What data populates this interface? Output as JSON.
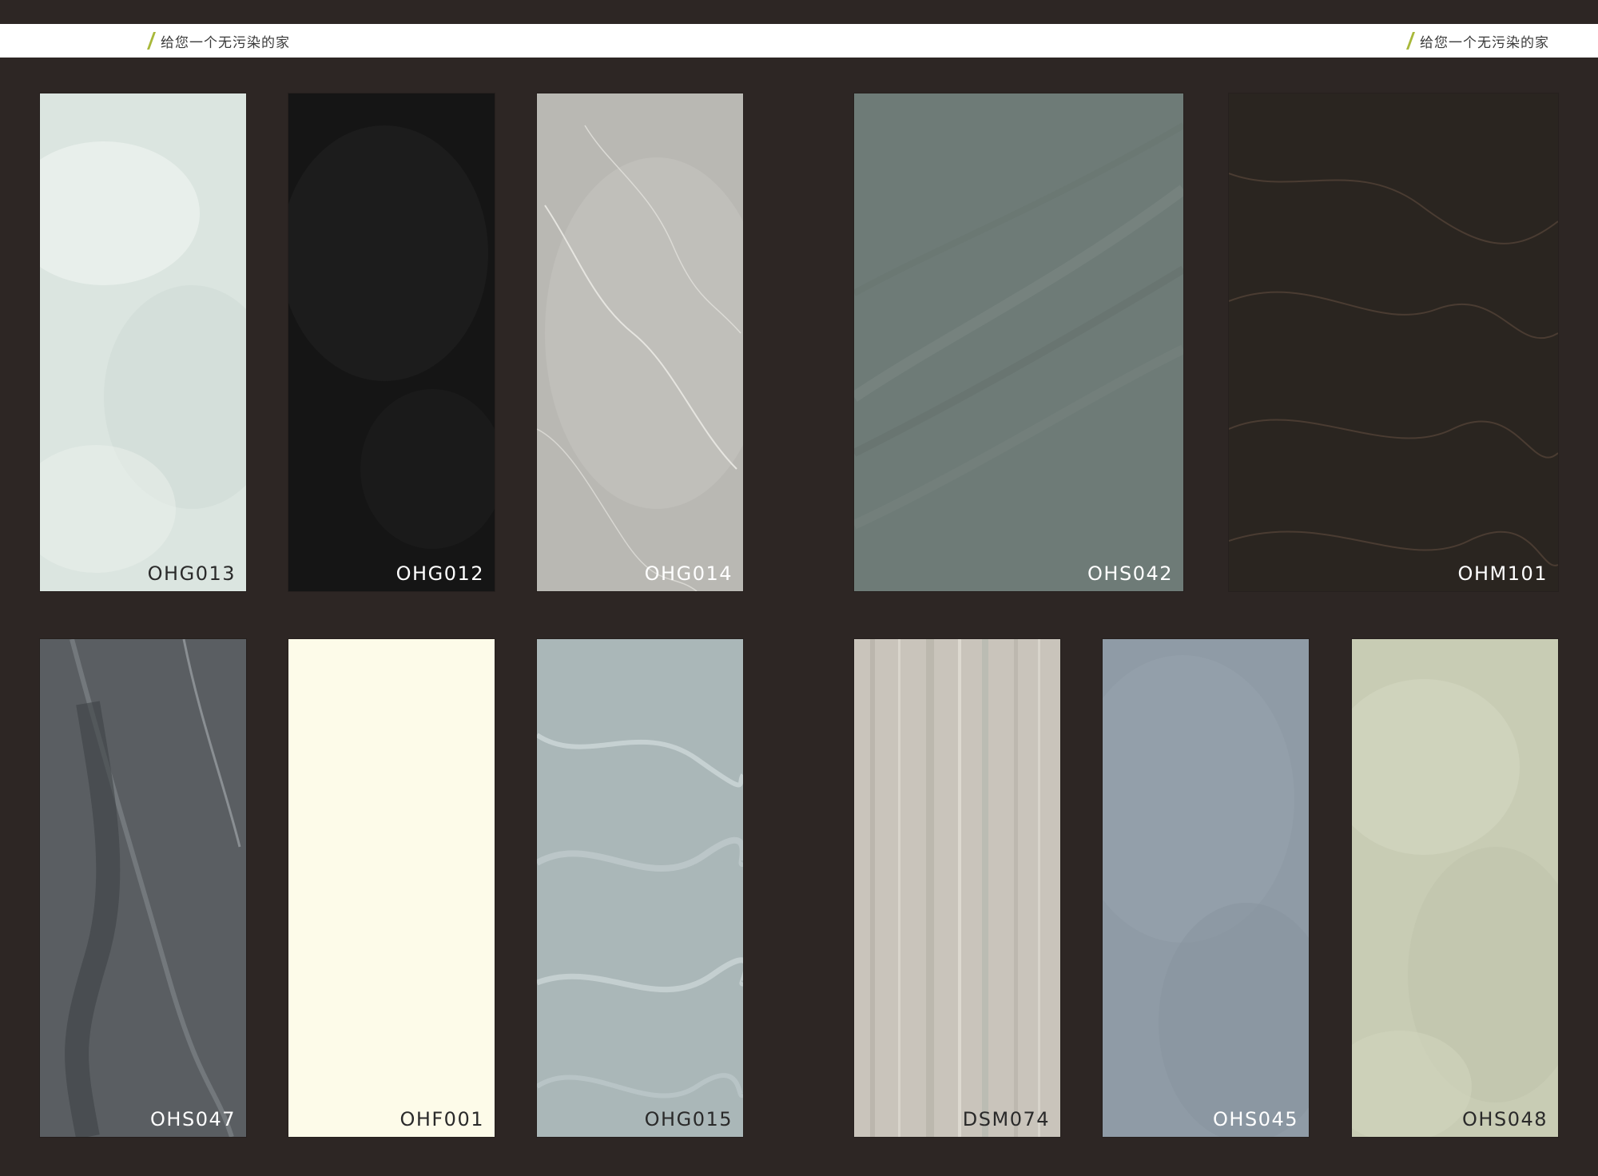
{
  "header": {
    "tagline_left": "给您一个无污染的家",
    "tagline_right": "给您一个无污染的家",
    "accent_color": "#a8b83a"
  },
  "swatches": [
    {
      "code": "OHG013",
      "base": "#dbe5e0"
    },
    {
      "code": "OHG012",
      "base": "#151515"
    },
    {
      "code": "OHG014",
      "base": "#b9b8b3"
    },
    {
      "code": "OHS042",
      "base": "#6e7b77"
    },
    {
      "code": "OHM101",
      "base": "#2a2520"
    },
    {
      "code": "OHS047",
      "base": "#5a5e62"
    },
    {
      "code": "OHF001",
      "base": "#fdfbe9"
    },
    {
      "code": "OHG015",
      "base": "#aab7b8"
    },
    {
      "code": "DSM074",
      "base": "#c9c4bb"
    },
    {
      "code": "OHS045",
      "base": "#8f9ba6"
    },
    {
      "code": "OHS048",
      "base": "#c8ccb4"
    }
  ]
}
